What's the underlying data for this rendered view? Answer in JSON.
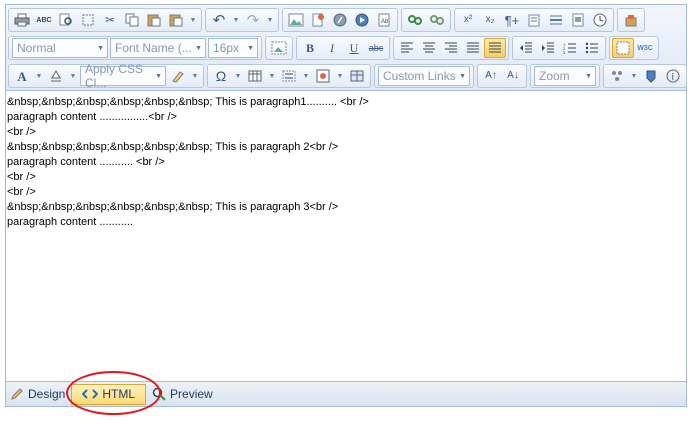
{
  "toolbar": {
    "paragraph_format": "Normal",
    "font_name": "Font Name (...",
    "font_size": "16px",
    "css_class": "Apply CSS Cl...",
    "custom_links": "Custom Links",
    "zoom": "Zoom",
    "superscript": "x²",
    "subscript": "x₂",
    "bold": "B",
    "italic": "I",
    "underline": "U",
    "strikethrough": "abc",
    "font_color": "A",
    "symbol": "Ω",
    "spellcheck": "ABC",
    "w3c": "W3C"
  },
  "content": {
    "lines": [
      "&nbsp;&nbsp;&nbsp;&nbsp;&nbsp;&nbsp; This is paragraph1.......... <br />",
      "paragraph content ................<br />",
      "<br />",
      "&nbsp;&nbsp;&nbsp;&nbsp;&nbsp;&nbsp; This is paragraph 2<br />",
      "paragraph content ........... <br />",
      "<br />",
      "<br />",
      "&nbsp;&nbsp;&nbsp;&nbsp;&nbsp;&nbsp; This is paragraph 3<br />",
      "paragraph content ..........."
    ]
  },
  "footer": {
    "design_label": "Design",
    "html_label": "HTML",
    "preview_label": "Preview"
  },
  "colors": {
    "accent": "#fbd872",
    "highlight_circle": "#e01818",
    "border": "#a3bad9"
  }
}
